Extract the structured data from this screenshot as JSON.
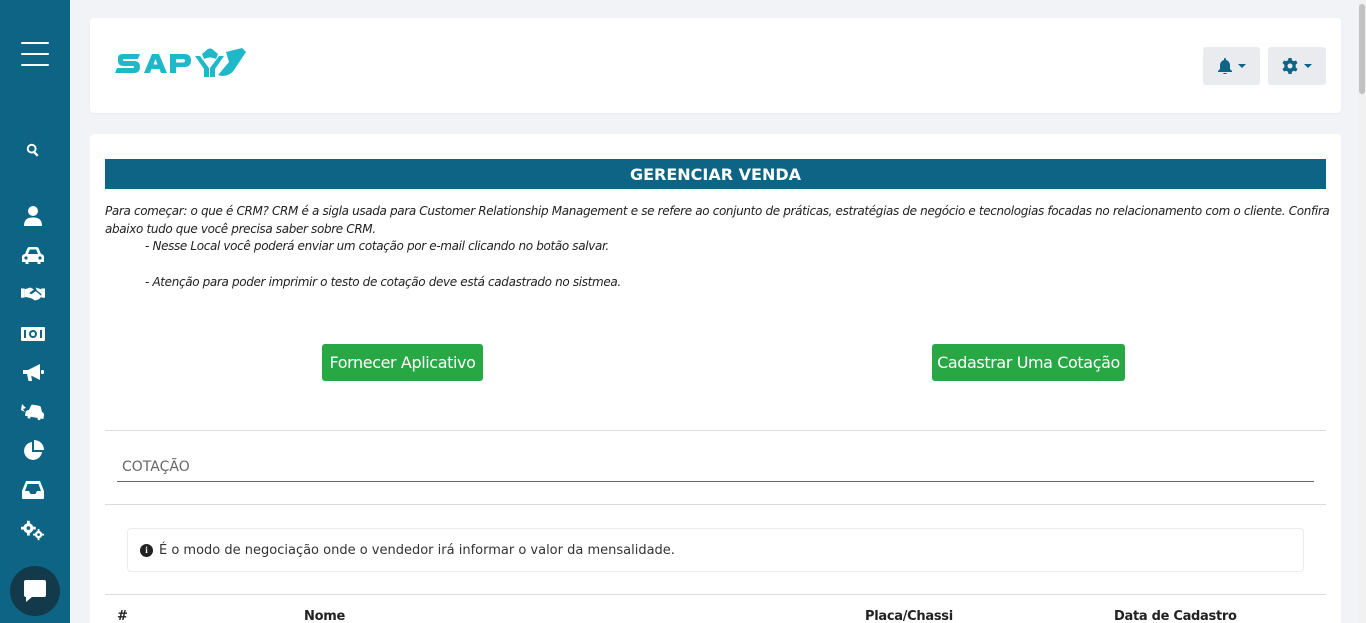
{
  "sidebar": {
    "icons": [
      "menu-icon",
      "search-icon",
      "user-icon",
      "car-icon",
      "handshake-icon",
      "money-icon",
      "megaphone-icon",
      "car-crash-icon",
      "pie-chart-icon",
      "inbox-icon",
      "cogs-icon",
      "chat-icon"
    ]
  },
  "header": {
    "logo_text": "SAP",
    "bell_icon": "bell-icon",
    "settings_icon": "gear-icon"
  },
  "main": {
    "title": "GERENCIAR VENDA",
    "intro": "Para começar: o que é CRM? CRM é a sigla usada para Customer Relationship Management e se refere ao conjunto de práticas, estratégias de negócio e tecnologias focadas no relacionamento com o cliente. Confira abaixo tudo que você precisa saber sobre CRM.",
    "bullet_1": "- Nesse Local você poderá enviar um cotação por e-mail clicando no botão salvar.",
    "bullet_2": "- Atenção para poder imprimir o testo de cotação deve está cadastrado no sistmea.",
    "btn_app": "Fornecer Aplicativo",
    "btn_quote": "Cadastrar Uma Cotação",
    "section_title": "COTAÇÃO",
    "info_text": "É o modo de negociação onde o vendedor irá informar o valor da mensalidade.",
    "table_headers": {
      "num": "#",
      "name": "Nome",
      "plate": "Placa/Chassi",
      "date": "Data de Cadastro"
    }
  },
  "colors": {
    "primary": "#0e6484",
    "success": "#28a745",
    "logo": "#1fb8c8"
  }
}
